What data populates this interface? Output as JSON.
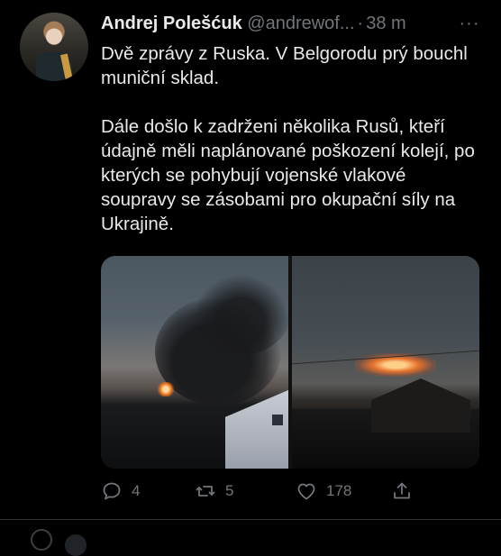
{
  "tweet": {
    "author_name": "Andrej Polešćuk",
    "handle": "@andrewof...",
    "separator": "·",
    "time": "38 m",
    "more": "···",
    "paragraphs": [
      "Dvě zprávy z Ruska. V Belgorodu prý bouchl muniční sklad.",
      "Dále došlo k zadrženi několika Rusů, kteří údajně měli naplánované poškození kolejí, po kterých se pohybují vojenské vlakové soupravy se zásobami pro okupační síly na Ukrajině."
    ],
    "actions": {
      "reply_count": "4",
      "retweet_count": "5",
      "like_count": "178"
    }
  },
  "icons": {
    "reply": "reply-icon",
    "retweet": "retweet-icon",
    "like": "heart-icon",
    "share": "share-icon",
    "more": "more-icon"
  },
  "colors": {
    "background": "#000000",
    "text": "#e7e9ea",
    "secondary": "#71767b",
    "divider": "#2f3336"
  }
}
